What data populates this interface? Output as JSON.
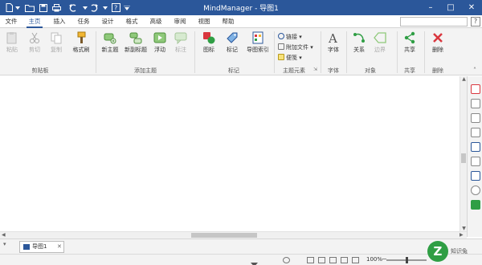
{
  "title_bar": {
    "title": "MindManager - 导图1",
    "quick_access_icons": [
      "new-document-icon",
      "open-folder-icon",
      "save-icon",
      "print-icon",
      "undo-icon",
      "redo-icon",
      "help-icon",
      "customize-icon"
    ],
    "window_controls": {
      "minimize": "–",
      "restore": "□",
      "close": "✕"
    },
    "colors": {
      "background": "#2b579a",
      "text": "#ffffff"
    }
  },
  "menu_tabs": [
    {
      "label": "文件",
      "active": false
    },
    {
      "label": "主页",
      "active": true
    },
    {
      "label": "插入",
      "active": false
    },
    {
      "label": "任务",
      "active": false
    },
    {
      "label": "设计",
      "active": false
    },
    {
      "label": "格式",
      "active": false
    },
    {
      "label": "高级",
      "active": false
    },
    {
      "label": "审阅",
      "active": false
    },
    {
      "label": "视图",
      "active": false
    },
    {
      "label": "帮助",
      "active": false
    }
  ],
  "help_button": "?",
  "ribbon": {
    "clipboard": {
      "group_label": "剪贴板",
      "paste": "粘贴",
      "cut": "剪切",
      "copy": "复制",
      "format_painter": "格式刷"
    },
    "add_topic": {
      "group_label": "添加主题",
      "new_topic": "新主题",
      "new_subtopic": "新副标题",
      "float": "浮动",
      "callout": "标注"
    },
    "markers": {
      "group_label": "标记",
      "icon": "图标",
      "tag": "标记",
      "map_index": "导图索引"
    },
    "topic_elements": {
      "group_label": "主题元素",
      "link": "链接",
      "attach_file": "附加文件",
      "note": "便笺"
    },
    "font": {
      "group_label": "字体",
      "font": "字体"
    },
    "objects": {
      "group_label": "对象",
      "relationship": "关系",
      "boundary": "边界"
    },
    "share": {
      "group_label": "共享",
      "share": "共享"
    },
    "delete": {
      "group_label": "删除",
      "delete": "删除"
    }
  },
  "document_tab": {
    "label": "导图1",
    "close": "✕"
  },
  "status_bar": {
    "zoom": "100%"
  },
  "watermark": {
    "logo_letter": "Z",
    "text": "知识兔"
  }
}
